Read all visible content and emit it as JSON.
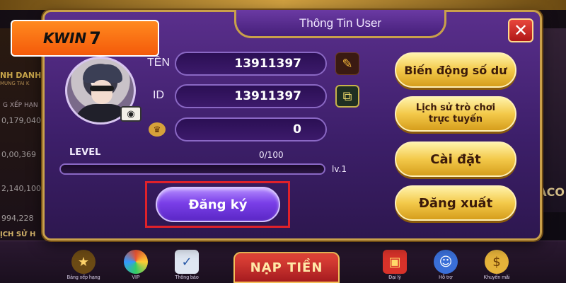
{
  "dialog": {
    "title": "Thông Tin User",
    "close_symbol": "✕"
  },
  "logo": {
    "text": "KWIN",
    "mark": "7"
  },
  "profile": {
    "name_label": "TÊN",
    "name_value": "13911397",
    "id_label": "ID",
    "id_value": "13911397",
    "balance_value": "0",
    "level_label": "LEVEL",
    "level_progress": "0/100",
    "level_value": "lv.1",
    "level_fraction": 0
  },
  "actions": {
    "register_label": "Đăng ký",
    "balance_history": "Biến động số dư",
    "game_history": "Lịch sử trò chơi trực tuyến",
    "settings": "Cài đặt",
    "logout": "Đăng xuất"
  },
  "background": {
    "left_title": "NH DANH",
    "left_sub": "MUNG TAI K",
    "left_rank": "G XẾP HẠN",
    "numbers": [
      "0,179,040",
      "0,00,369",
      "2,140,100",
      "994,228"
    ],
    "history": "ỊCH SỬ H",
    "right_text": "ACO",
    "nap_tien": "NẠP TIỀN",
    "nav": [
      {
        "label": "Bảng xếp hạng",
        "icon": "trophy-icon"
      },
      {
        "label": "VIP",
        "icon": "wheel-icon"
      },
      {
        "label": "Thông báo",
        "icon": "notice-icon"
      },
      {
        "label": "Đại lý",
        "icon": "gift-icon"
      },
      {
        "label": "Hỗ trợ",
        "icon": "support-icon"
      },
      {
        "label": "Khuyến mãi",
        "icon": "coin-icon"
      }
    ]
  },
  "colors": {
    "dialog_bg": "#4a2578",
    "gold": "#c9a04a",
    "register": "#7a3fe8",
    "highlight_frame": "#e0212a"
  }
}
